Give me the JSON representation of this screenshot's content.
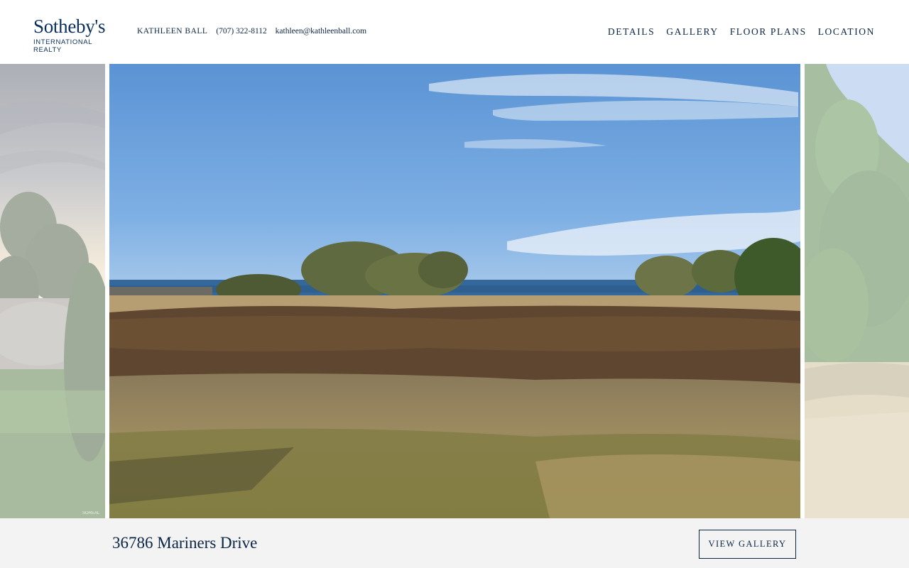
{
  "brand": {
    "name": "Sotheby's",
    "sub": "INTERNATIONAL REALTY"
  },
  "agent": {
    "name": "KATHLEEN BALL",
    "phone": "(707) 322-8112",
    "email": "kathleen@kathleenball.com"
  },
  "nav": {
    "items": [
      "DETAILS",
      "GALLERY",
      "FLOOR PLANS",
      "LOCATION"
    ]
  },
  "carousel": {
    "slides": [
      {
        "name": "sunset-landscape"
      },
      {
        "name": "ocean-view-meadow"
      },
      {
        "name": "pine-trees-grass"
      }
    ],
    "watermark": "SOREAL"
  },
  "listing": {
    "address": "36786 Mariners Drive",
    "gallery_button": "VIEW GALLERY"
  },
  "colors": {
    "brand_navy": "#0b2545",
    "bar_bg": "#f3f3f3"
  }
}
